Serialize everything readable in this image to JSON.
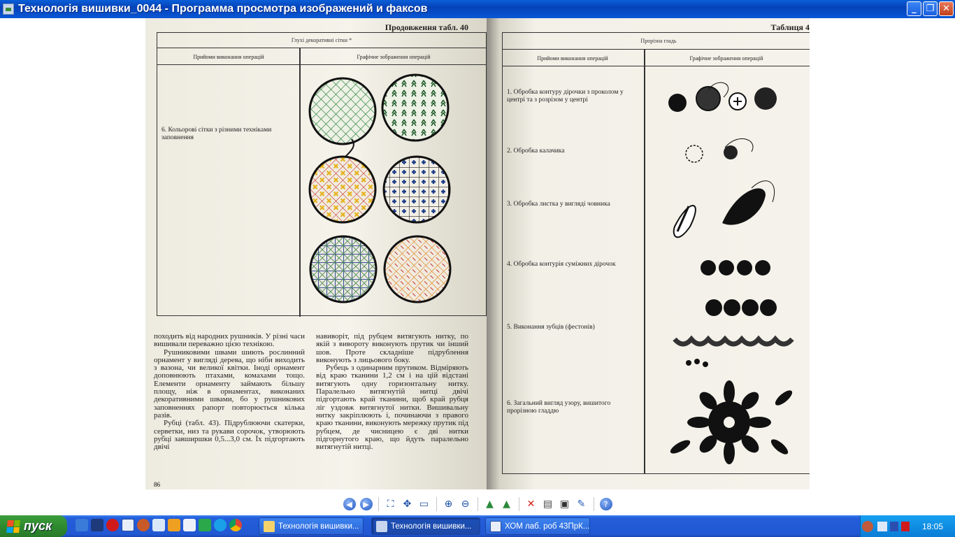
{
  "window": {
    "title": "Технологія вишивки_0044 - Программа просмотра изображений и факсов",
    "controls": {
      "minimize": "_",
      "restore": "❐",
      "close": "✕"
    }
  },
  "left_page": {
    "heading": "Продовження табл. 40",
    "table_title": "Глухі декоративні сітки *",
    "col1": "Прийоми виконання операцій",
    "col2": "Графічне зображення операцій",
    "row_text": "6. Кольорові сітки з різними техніками заповнення",
    "body_col1": [
      "походить від народних рушників. У різні часи вишивали переважно цією технікою.",
      "Рушниковими швами шиють рослинний орнамент у вигляді дерева, що ніби виходить з вазона, чи великої квітки. Іноді орнамент доповнюють птахами, комахами тощо. Елементи орнаменту займають більшу площу, ніж в орнаментах, виконаних декоративними швами, бо у рушникових заповненнях рапорт повторюється кілька разів.",
      "Рубці (табл. 43). Підрублюючи скатерки, серветки, низ та рукави сорочок, утворюють рубці завширшки 0,5...3,0 см. Їх підгортають двічі"
    ],
    "body_col2": [
      "навиворіт, під рубцем витягують нитку, по якій з вивороту виконують прутик чи інший шов. Проте складніше підрублення виконують з лицьового боку.",
      "Рубець з одинарним прутиком. Відміряють від краю тканини 1,2 см і на цій відстані витягують одну горизонтальну нитку. Паралельно витягнутій нитці двічі підгортають край тканини, щоб край рубця ліг уздовж витягнутої нитки. Вишивальну нитку закріплюють і, починаючи з правого краю тканини, виконують мережку прутик під рубцем, де чисницею є дві нитки підгорнутого краю, що йдуть паралельно витягнутій нитці."
    ],
    "page_number": "86"
  },
  "right_page": {
    "heading": "Таблиця 4",
    "table_title": "Прорізна гладь",
    "col1": "Прийоми виконання операцій",
    "col2": "Графічне зображення операцій",
    "rows": [
      "1. Обробка контуру дірочки з проколом у центрі та з розрізом у центрі",
      "2. Обробка калачика",
      "3. Обробка листка у вигляді човника",
      "4. Обробка контурія суміжних дірочок",
      "5. Виконання зубців (фестонів)",
      "6. Загальний вигляд узору, вишитого прорізною гладдю"
    ]
  },
  "toolbar": {
    "buttons": [
      "prev-icon",
      "next-icon",
      "best-fit-icon",
      "actual-size-icon",
      "slideshow-icon",
      "zoom-in-icon",
      "zoom-out-icon",
      "rotate-cw-icon",
      "rotate-ccw-icon",
      "delete-icon",
      "print-icon",
      "save-icon",
      "edit-icon",
      "help-icon"
    ]
  },
  "taskbar": {
    "start_label": "пуск",
    "tasks": [
      {
        "label": "Технологія вишивки...",
        "active": false
      },
      {
        "label": "Технологія вишивки...",
        "active": true
      },
      {
        "label": "ХОМ лаб. роб 43ПрК...",
        "active": false
      }
    ],
    "language": "UK",
    "clock": "18:05"
  },
  "colors": {
    "titlebar": "#0a5fd8",
    "taskbar": "#245edb",
    "start": "#2f8a2f",
    "tray": "#0f8ee3"
  }
}
